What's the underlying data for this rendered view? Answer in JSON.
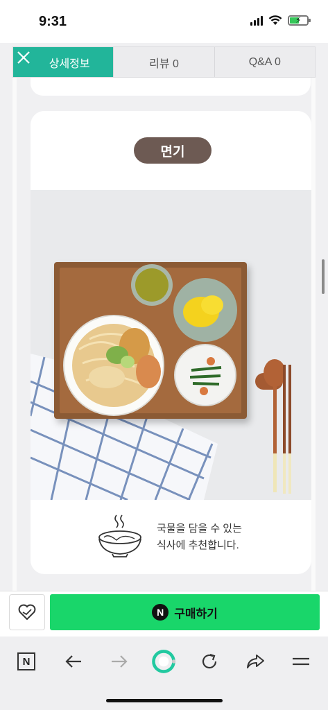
{
  "status_bar": {
    "time": "9:31"
  },
  "tabs": {
    "items": [
      {
        "label": "상세정보",
        "active": true
      },
      {
        "label": "리뷰  0",
        "active": false
      },
      {
        "label": "Q&A  0",
        "active": false
      }
    ]
  },
  "section": {
    "title": "면기"
  },
  "description": {
    "line1": "국물을 담을 수 있는",
    "line2": "식사에 추천합니다."
  },
  "purchase": {
    "buy_label": "구매하기",
    "pay_badge": "N"
  },
  "browser_toolbar": {
    "home_label": "N",
    "icons": [
      "n-home-icon",
      "back-arrow-icon",
      "forward-arrow-icon",
      "green-window-icon",
      "refresh-icon",
      "share-icon",
      "menu-icon"
    ]
  },
  "colors": {
    "tab_active": "#22b59a",
    "buy_button": "#19d66a",
    "section_pill": "#6d5a53"
  }
}
